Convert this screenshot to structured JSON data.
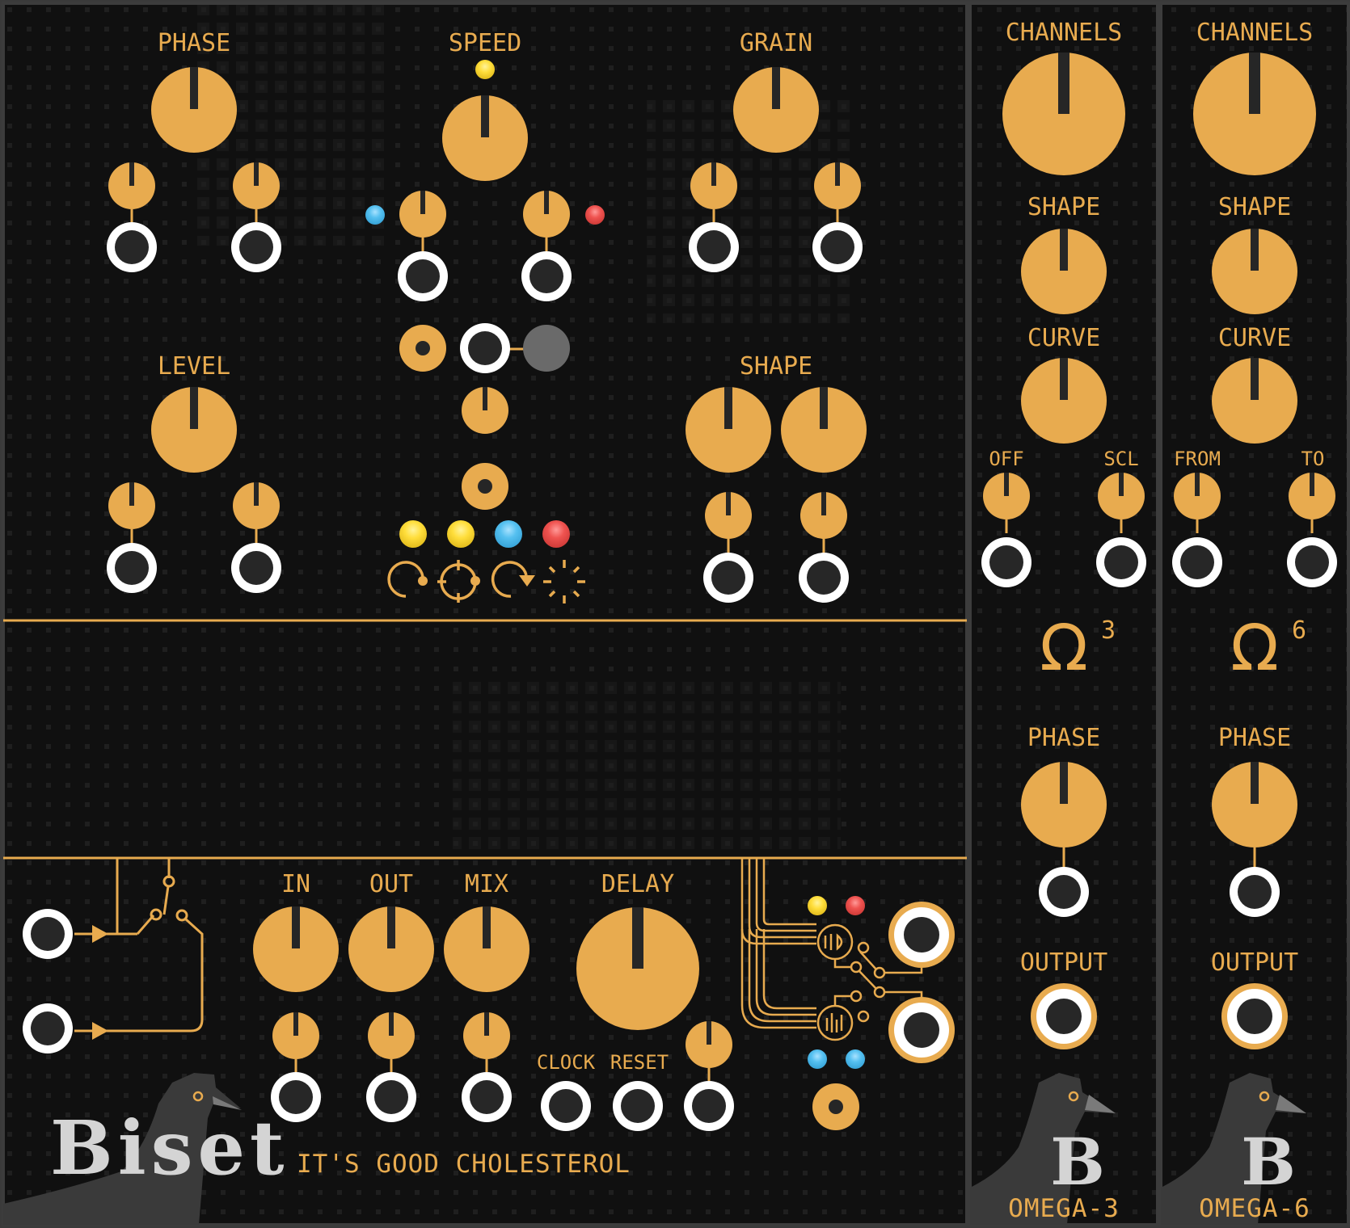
{
  "colors": {
    "panel_bg": "#101010",
    "accent": "#e8ab4f",
    "knob_pointer": "#262626",
    "jack_ring": "#ffffff",
    "jack_hole": "#272727",
    "led_yellow": "#ffde3b",
    "led_blue": "#55c0f0",
    "led_red": "#ef5350",
    "button_gray": "#6a6a6a",
    "pigeon": "#3a3a3a",
    "logo_text": "#d4d4d4"
  },
  "main_module": {
    "name": "Biset",
    "tagline": "IT'S GOOD CHOLESTEROL",
    "top_section": {
      "phase_label": "PHASE",
      "speed_label": "SPEED",
      "grain_label": "GRAIN",
      "level_label": "LEVEL",
      "shape_label": "SHAPE",
      "leds": [
        "yellow",
        "yellow",
        "blue",
        "red"
      ],
      "mode_icons": [
        "loop-forward-icon",
        "loop-pingpong-icon",
        "loop-reverse-icon",
        "random-burst-icon"
      ]
    },
    "bottom_section": {
      "in_label": "IN",
      "out_label": "OUT",
      "mix_label": "MIX",
      "delay_label": "DELAY",
      "clock_label": "CLOCK",
      "reset_label": "RESET",
      "leds": [
        "yellow",
        "red",
        "blue",
        "blue"
      ]
    }
  },
  "omega3": {
    "name": "OMEGA-3",
    "symbol": "Ω",
    "exponent": "3",
    "channels_label": "CHANNELS",
    "shape_label": "SHAPE",
    "curve_label": "CURVE",
    "left_label": "OFF",
    "right_label": "SCL",
    "phase_label": "PHASE",
    "output_label": "OUTPUT",
    "logo_letter": "B"
  },
  "omega6": {
    "name": "OMEGA-6",
    "symbol": "Ω",
    "exponent": "6",
    "channels_label": "CHANNELS",
    "shape_label": "SHAPE",
    "curve_label": "CURVE",
    "left_label": "FROM",
    "right_label": "TO",
    "phase_label": "PHASE",
    "output_label": "OUTPUT",
    "logo_letter": "B"
  }
}
